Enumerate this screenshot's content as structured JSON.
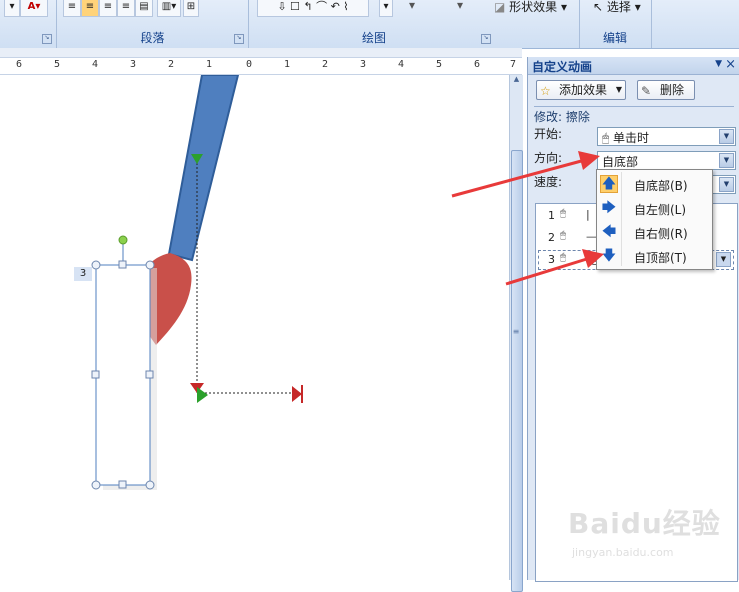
{
  "ribbon": {
    "groups": [
      {
        "label": "段落"
      },
      {
        "label": "绘图"
      },
      {
        "label": "编辑"
      }
    ],
    "buttons": {
      "font_color": "A",
      "shape_effects": "形状效果",
      "select": "选择"
    }
  },
  "ruler": {
    "ticks": [
      "6",
      "5",
      "4",
      "3",
      "2",
      "1",
      "0",
      "1",
      "2",
      "3",
      "4",
      "5",
      "6",
      "7"
    ]
  },
  "slide": {
    "shape_number": "3"
  },
  "task_pane": {
    "title": "自定义动画",
    "add_effect": "添加效果",
    "remove": "删除",
    "modify_line": "修改: 擦除",
    "start_label": "开始:",
    "start_value": "单击时",
    "direction_label": "方向:",
    "direction_value": "自底部",
    "speed_label": "速度:",
    "items": [
      {
        "num": "1",
        "body": "|"
      },
      {
        "num": "2",
        "body": "—"
      },
      {
        "num": "3",
        "body": "矩"
      }
    ]
  },
  "direction_menu": {
    "options": [
      {
        "label": "自底部(B)",
        "icon": "arrow-up-icon"
      },
      {
        "label": "自左侧(L)",
        "icon": "arrow-right-icon"
      },
      {
        "label": "自右侧(R)",
        "icon": "arrow-left-icon"
      },
      {
        "label": "自顶部(T)",
        "icon": "arrow-down-icon"
      }
    ]
  },
  "watermark": {
    "brand": "Baidu经验",
    "url": "jingyan.baidu.com"
  },
  "colors": {
    "pointer_arrow": "#e83a3a",
    "brush_handle": "#4f7fbf",
    "brush_tip": "#c9504a",
    "accent": "#15428b"
  }
}
